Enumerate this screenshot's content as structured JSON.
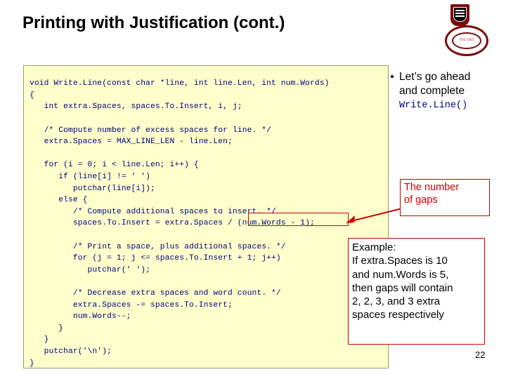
{
  "slide": {
    "title": "Printing with Justification (cont.)",
    "page_number": "22",
    "logo": {
      "name": "princeton-shield-logo",
      "wreath_text": "VIG DEI"
    },
    "code": "void Write.Line(const char *line, int line.Len, int num.Words)\n{\n   int extra.Spaces, spaces.To.Insert, i, j;\n\n   /* Compute number of excess spaces for line. */\n   extra.Spaces = MAX_LINE_LEN - line.Len;\n\n   for (i = 0; i < line.Len; i++) {\n      if (line[i] != ' ')\n         putchar(line[i]);\n      else {\n         /* Compute additional spaces to insert. */\n         spaces.To.Insert = extra.Spaces / (num.Words - 1);\n\n         /* Print a space, plus additional spaces. */\n         for (j = 1; j <= spaces.To.Insert + 1; j++)\n            putchar(' ');\n\n         /* Decrease extra spaces and word count. */\n         extra.Spaces -= spaces.To.Insert;\n         num.Words--;\n      }\n   }\n   putchar('\\n');\n}",
    "bullet": {
      "line1": "Let’s go ahead",
      "line2": "and complete",
      "code_label": "Write.Line()"
    },
    "callouts": {
      "gaps": {
        "line1": "The number",
        "line2": "of gaps",
        "color": "#cc0000"
      },
      "example": {
        "line1": "Example:",
        "line2": "If extra.Spaces is 10",
        "line3": "and num.Words is 5,",
        "line4": "then gaps will contain",
        "line5": "2, 2, 3, and 3 extra",
        "line6": "spaces respectively",
        "color": "#cc0000"
      }
    }
  }
}
